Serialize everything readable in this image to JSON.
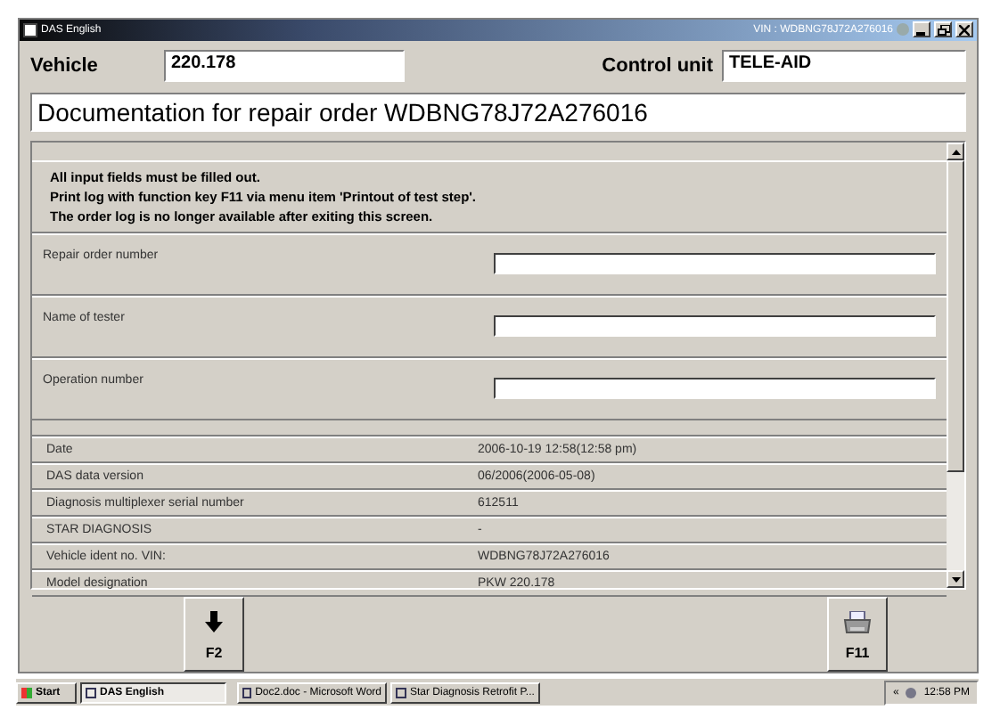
{
  "window": {
    "title": "DAS English",
    "vin": "VIN : WDBNG78J72A276016"
  },
  "header": {
    "vehicle_label": "Vehicle",
    "vehicle": "220.178",
    "control_unit_label": "Control unit",
    "control_unit": "TELE-AID"
  },
  "heading": "Documentation for repair order WDBNG78J72A276016",
  "notice": [
    "All input fields must be filled out.",
    "Print log with function key F11 via menu item 'Printout of test step'.",
    "The order log is no longer available after exiting this screen."
  ],
  "fields": [
    {
      "label": "Repair order number"
    },
    {
      "label": "Name of tester"
    },
    {
      "label": "Operation number"
    }
  ],
  "info": [
    {
      "label": "Date",
      "value": "2006-10-19 12:58(12:58 pm)"
    },
    {
      "label": "DAS data version",
      "value": "06/2006(2006-05-08)"
    },
    {
      "label": "Diagnosis multiplexer serial number",
      "value": "612511"
    },
    {
      "label": "STAR DIAGNOSIS",
      "value": "-"
    },
    {
      "label": "Vehicle ident no. VIN:",
      "value": "WDBNG78J72A276016"
    },
    {
      "label": "Model designation",
      "value": "PKW 220.178"
    }
  ],
  "buttons": [
    {
      "kind": "down",
      "label": "F2"
    },
    {
      "kind": "print",
      "label": "F11"
    }
  ],
  "taskbar": {
    "start": "Start",
    "tasks": [
      {
        "label": "DAS English",
        "selected": true
      },
      {
        "label": "Doc2.doc - Microsoft Word",
        "selected": false
      },
      {
        "label": "Star Diagnosis Retrofit P...",
        "selected": false
      }
    ],
    "tray_arrow": "«",
    "clock": "12:58 PM"
  }
}
